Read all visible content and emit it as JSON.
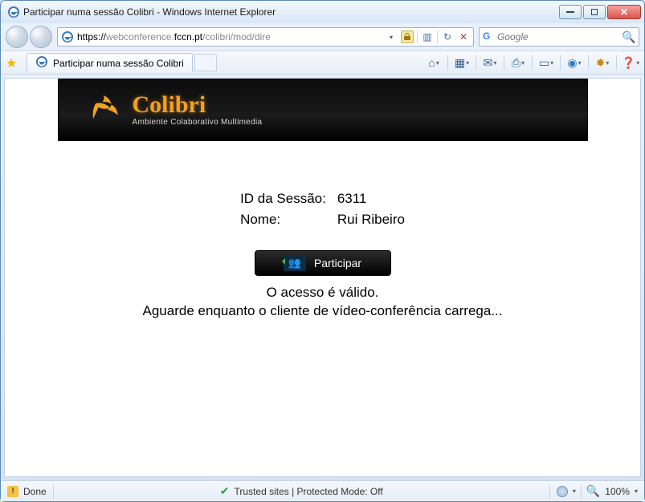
{
  "window": {
    "title": "Participar numa sessão Colibri - Windows Internet Explorer"
  },
  "nav": {
    "url_prefix_scheme": "https://",
    "url_grey1": "webconference.",
    "url_bold": "fccn.pt",
    "url_grey2": "/colibri/mod/dire",
    "refresh_glyph": "↻",
    "stop_glyph": "✕",
    "search_placeholder": "Google"
  },
  "tab": {
    "title": "Participar numa sessão Colibri"
  },
  "toolbar": {
    "home_glyph": "⌂",
    "feeds_glyph": "▦",
    "mail_glyph": "✉",
    "print_glyph": "⎙",
    "page_glyph": "▭",
    "safety_glyph": "◉",
    "tools_glyph": "✸",
    "help_glyph": "❓"
  },
  "brand": {
    "name": "Colibri",
    "subtitle": "Ambiente Colaborativo Multimedia"
  },
  "session": {
    "id_label": "ID da Sessão:",
    "id_value": "6311",
    "name_label": "Nome:",
    "name_value": "Rui Ribeiro"
  },
  "participate": {
    "label": "Participar"
  },
  "message": {
    "line1": "O acesso é válido.",
    "line2": "Aguarde enquanto o cliente de vídeo-conferência carrega..."
  },
  "status": {
    "done": "Done",
    "security": "Trusted sites | Protected Mode: Off",
    "zoom": "100%"
  }
}
